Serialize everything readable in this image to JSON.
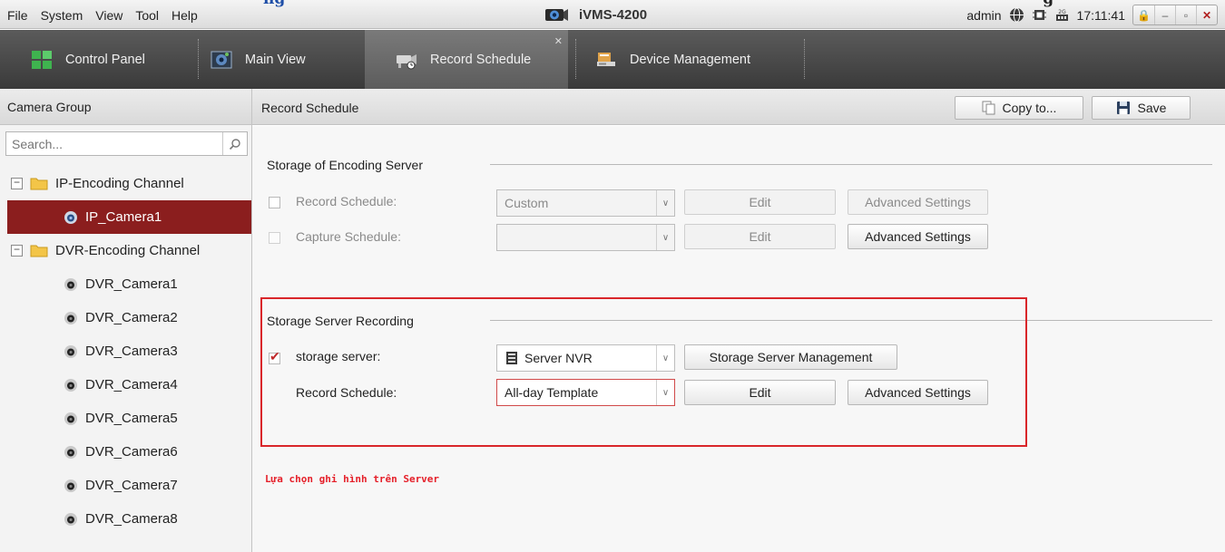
{
  "header_cutoff": {
    "left": "ng",
    "right": "g"
  },
  "menu": [
    "File",
    "System",
    "View",
    "Tool",
    "Help"
  ],
  "app_title": "iVMS-4200",
  "status": {
    "user": "admin",
    "time": "17:11:41"
  },
  "tabs": [
    {
      "label": "Control Panel",
      "icon": "control-panel-icon"
    },
    {
      "label": "Main View",
      "icon": "main-view-icon"
    },
    {
      "label": "Record Schedule",
      "icon": "record-schedule-icon",
      "active": true
    },
    {
      "label": "Device Management",
      "icon": "device-management-icon"
    }
  ],
  "sidebar": {
    "title": "Camera Group",
    "search_placeholder": "Search...",
    "groups": [
      {
        "label": "IP-Encoding Channel",
        "cameras": [
          "IP_Camera1"
        ]
      },
      {
        "label": "DVR-Encoding Channel",
        "cameras": [
          "DVR_Camera1",
          "DVR_Camera2",
          "DVR_Camera3",
          "DVR_Camera4",
          "DVR_Camera5",
          "DVR_Camera6",
          "DVR_Camera7",
          "DVR_Camera8"
        ]
      }
    ],
    "selected": "IP_Camera1"
  },
  "main": {
    "title": "Record Schedule",
    "copy_label": "Copy to...",
    "save_label": "Save",
    "encoding": {
      "title": "Storage of Encoding Server",
      "record_label": "Record Schedule:",
      "record_value": "Custom",
      "capture_label": "Capture Schedule:",
      "capture_value": "",
      "edit_label": "Edit",
      "advanced_label": "Advanced Settings"
    },
    "storage": {
      "title": "Storage Server Recording",
      "server_label": "storage server:",
      "server_value": "Server NVR",
      "manage_label": "Storage Server Management",
      "record_label": "Record Schedule:",
      "record_value": "All-day Template",
      "edit_label": "Edit",
      "advanced_label": "Advanced Settings"
    },
    "note": "Lựa chọn ghi hình trên Server"
  },
  "colors": {
    "accent_red": "#d9262a",
    "selection": "#8b1e1e",
    "tabbar": "#4a4a4a"
  }
}
